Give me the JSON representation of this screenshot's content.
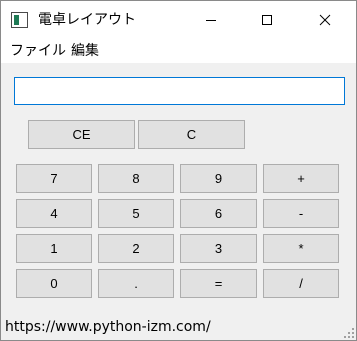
{
  "window": {
    "title": "電卓レイアウト"
  },
  "menu": {
    "file": "ファイル",
    "edit": "編集"
  },
  "display": {
    "value": ""
  },
  "buttons": {
    "ce": "CE",
    "c": "C",
    "n7": "7",
    "n8": "8",
    "n9": "9",
    "plus": "+",
    "n4": "4",
    "n5": "5",
    "n6": "6",
    "minus": "-",
    "n1": "1",
    "n2": "2",
    "n3": "3",
    "multiply": "*",
    "n0": "0",
    "dot": ".",
    "equals": "=",
    "divide": "/"
  },
  "status": {
    "text": "https://www.python-izm.com/"
  },
  "icons": {
    "app": "window-icon",
    "minimize": "minimize-icon",
    "maximize": "maximize-icon",
    "close": "close-icon",
    "grip": "resize-grip-icon"
  }
}
